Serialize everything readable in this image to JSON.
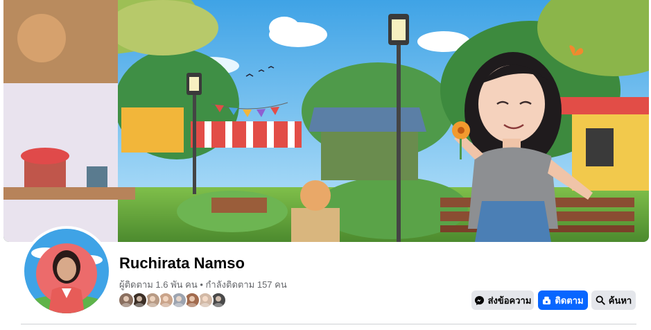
{
  "profile": {
    "name": "Ruchirata Namso",
    "followers_text": "ผู้ติดตาม 1.6 พัน คน",
    "separator": " • ",
    "following_text": "กำลังติดตาม 157 คน"
  },
  "followers_preview": [
    {
      "color": "#8a6f5f"
    },
    {
      "color": "#3d3027"
    },
    {
      "color": "#b89b85"
    },
    {
      "color": "#caa48a"
    },
    {
      "color": "#9da4b0"
    },
    {
      "color": "#a26b4e"
    },
    {
      "color": "#d2b9a6"
    },
    {
      "color": "#4a4a4a"
    }
  ],
  "actions": {
    "message_label": "ส่งข้อความ",
    "follow_label": "ติดตาม",
    "search_label": "ค้นหา"
  },
  "icons": {
    "message": "messenger-icon",
    "follow": "follow-icon",
    "search": "search-icon"
  },
  "colors": {
    "primary": "#0866ff",
    "secondary_button": "#e4e6eb",
    "secondary_text": "#65676b"
  }
}
